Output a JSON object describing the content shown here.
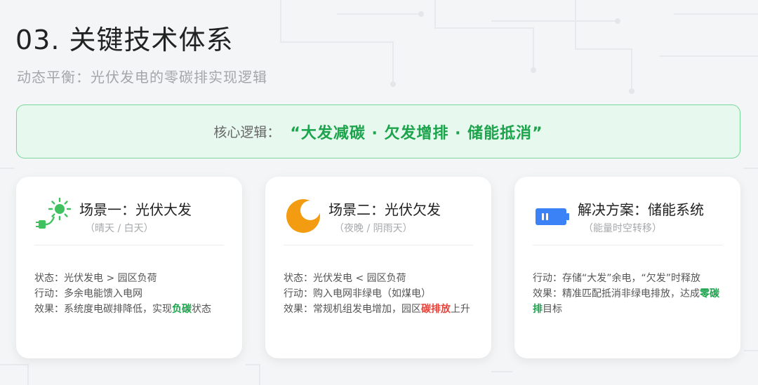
{
  "title": "03. 关键技术体系",
  "subtitle": "动态平衡：光伏发电的零碳排实现逻辑",
  "banner": {
    "label": "核心逻辑：",
    "slogan": "“大发减碳 · 欠发增排 · 储能抵消”"
  },
  "cards": [
    {
      "icon": "solar-plug-icon",
      "title": "场景一：光伏大发",
      "subtitle": "（晴天 / 白天）",
      "lines": [
        {
          "text": "状态：光伏发电 > 园区负荷"
        },
        {
          "text": "行动：多余电能馈入电网"
        },
        {
          "pre": "效果：系统度电碳排降低，实现",
          "highlight": "负碳",
          "post": "状态"
        }
      ]
    },
    {
      "icon": "moon-icon",
      "title": "场景二：光伏欠发",
      "subtitle": "（夜晚 / 阴雨天）",
      "lines": [
        {
          "text": "状态：光伏发电 < 园区负荷"
        },
        {
          "text": "行动：购入电网非绿电（如煤电）"
        },
        {
          "pre": "效果：常规机组发电增加，园区",
          "highlight": "碳排放",
          "post": "上升"
        }
      ]
    },
    {
      "icon": "battery-icon",
      "title": "解决方案：储能系统",
      "subtitle": "（能量时空转移）",
      "lines": [
        {
          "text": "行动：存储“大发”余电，“欠发”时释放"
        },
        {
          "pre": "效果：精准匹配抵消非绿电排放，达成",
          "highlight": "零碳排",
          "post": "目标"
        }
      ]
    }
  ],
  "colors": {
    "accent_green": "#1ba44b",
    "highlight_red": "#e8423a",
    "sun_green": "#3fc15f",
    "moon_orange": "#f39c12",
    "battery_blue": "#3b82f6"
  }
}
